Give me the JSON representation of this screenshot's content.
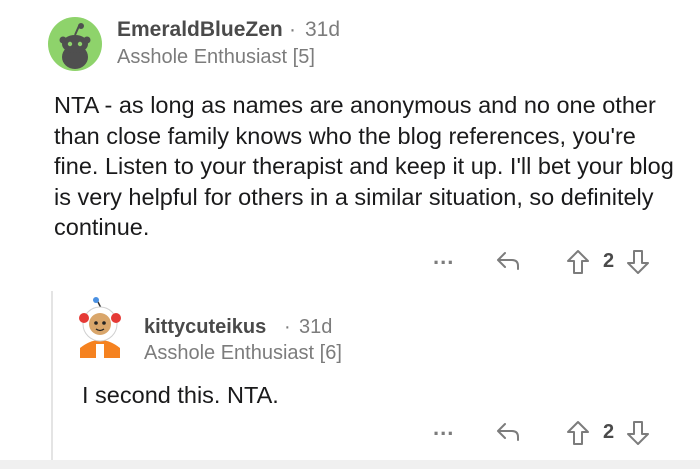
{
  "comment": {
    "username": "EmeraldBlueZen",
    "separator": "·",
    "age": "31d",
    "flair": "Asshole Enthusiast [5]",
    "body": "NTA - as long as names are anonymous and no one other than close family knows who the blog references, you're fine. Listen to your therapist and keep it up. I'll bet your blog is very helpful for others in a similar situation, so definitely continue.",
    "more_label": "...",
    "score": "2",
    "avatar_color": "#8ed36b"
  },
  "reply": {
    "username": "kittycuteikus",
    "separator": "·",
    "age": "31d",
    "flair": "Asshole Enthusiast [6]",
    "body": "I second this. NTA.",
    "more_label": "...",
    "score": "2"
  },
  "icons": {
    "reply": "reply-arrow-icon",
    "upvote": "upvote-arrow-icon",
    "downvote": "downvote-arrow-icon",
    "more": "more-options-icon"
  }
}
